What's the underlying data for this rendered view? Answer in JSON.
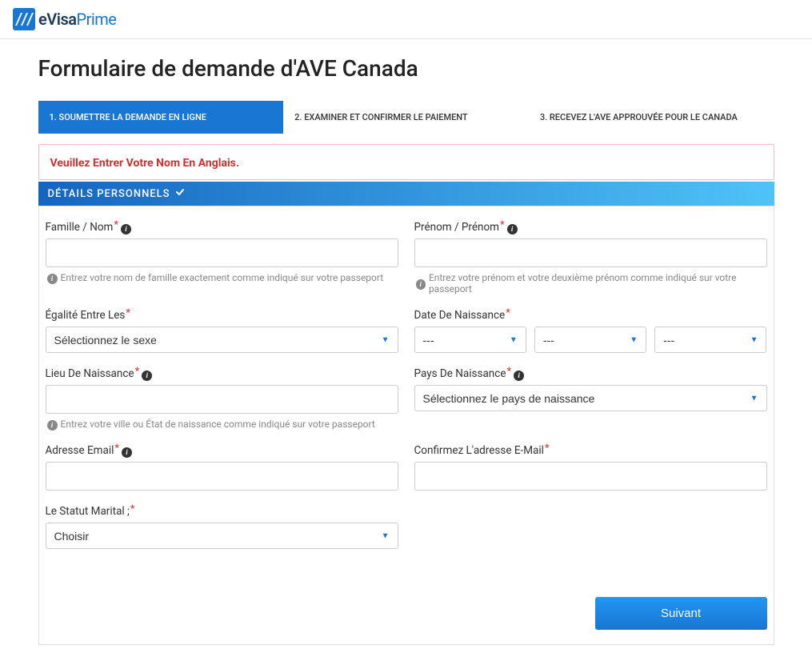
{
  "brand": {
    "part1": "eVisa",
    "part2": "Prime"
  },
  "page_title": "Formulaire de demande d'AVE Canada",
  "steps": {
    "step1": "1. SOUMETTRE LA DEMANDE EN LIGNE",
    "step2": "2. EXAMINER ET CONFIRMER LE PAIEMENT",
    "step3": "3. RECEVEZ L'AVE APPROUVÉE POUR LE CANADA"
  },
  "alert": "Veuillez Entrer Votre Nom En Anglais.",
  "section_title": "DÉTAILS PERSONNELS",
  "fields": {
    "family_name": {
      "label": "Famille / Nom",
      "help": "Entrez votre nom de famille exactement comme indiqué sur votre passeport"
    },
    "first_name": {
      "label": "Prénom / Prénom",
      "help": "Entrez votre prénom et votre deuxième prénom comme indiqué sur votre passeport"
    },
    "gender": {
      "label": "Égalité Entre Les",
      "placeholder": "Sélectionnez le sexe"
    },
    "dob": {
      "label": "Date De Naissance",
      "day_placeholder": "---",
      "month_placeholder": "---",
      "year_placeholder": "---"
    },
    "birthplace": {
      "label": "Lieu De Naissance",
      "help": "Entrez votre ville ou État de naissance comme indiqué sur votre passeport"
    },
    "birth_country": {
      "label": "Pays De Naissance",
      "placeholder": "Sélectionnez le pays de naissance"
    },
    "email": {
      "label": "Adresse Email"
    },
    "email_confirm": {
      "label": "Confirmez L'adresse E-Mail"
    },
    "marital_status": {
      "label": "Le Statut Marital ;",
      "placeholder": "Choisir"
    }
  },
  "buttons": {
    "next": "Suivant"
  },
  "required_mark": "*"
}
